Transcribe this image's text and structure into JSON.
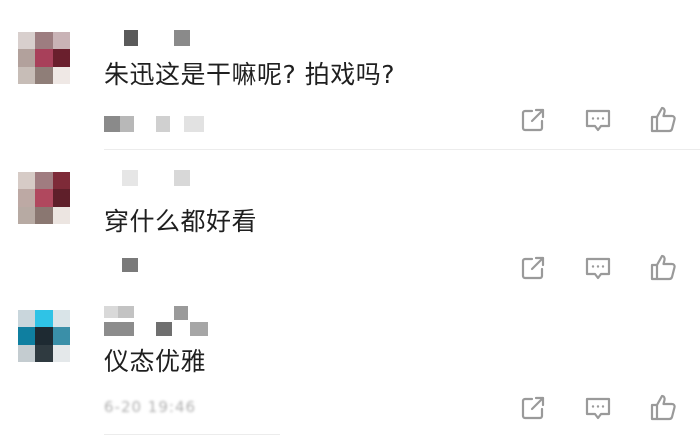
{
  "comments": [
    {
      "text": "朱迅这是干嘛呢? 拍戏吗?",
      "time": ""
    },
    {
      "text": "穿什么都好看",
      "time": ""
    },
    {
      "text": "仪态优雅",
      "time": "6-20 19:46"
    }
  ],
  "icons": {
    "share": "share-icon",
    "reply": "reply-icon",
    "like": "like-icon"
  },
  "colors": {
    "icon": "#9a9a9a",
    "text": "#1f1f1f",
    "muted": "#b0b0b0",
    "divider": "#ececec"
  }
}
